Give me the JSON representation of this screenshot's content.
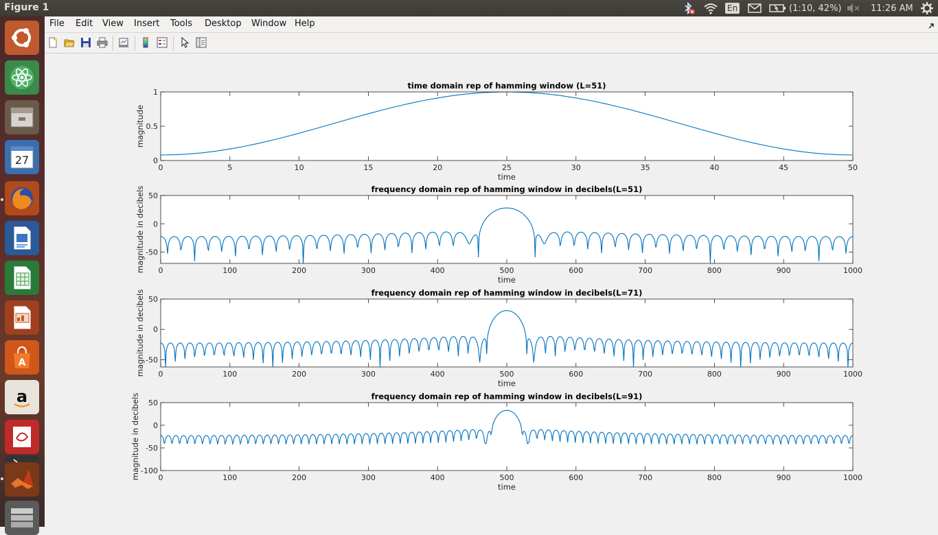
{
  "window": {
    "title": "Figure 1"
  },
  "tray": {
    "keyboard": "En",
    "battery": "(1:10, 42%)",
    "clock": "11:26 AM"
  },
  "launcher": {
    "calendar_day": "27"
  },
  "menu": [
    "File",
    "Edit",
    "View",
    "Insert",
    "Tools",
    "Desktop",
    "Window",
    "Help"
  ],
  "colors": {
    "line": "#0072bd",
    "figure_bg": "#f0f0f0",
    "axes_bg": "#ffffff"
  },
  "chart_data": [
    {
      "type": "line",
      "title": "time domain rep of hamming window (L=51)",
      "xlabel": "time",
      "ylabel": "magnitude",
      "xlim": [
        0,
        50
      ],
      "ylim": [
        0,
        1
      ],
      "xticks": [
        0,
        5,
        10,
        15,
        20,
        25,
        30,
        35,
        40,
        45,
        50
      ],
      "yticks": [
        0,
        0.5,
        1
      ],
      "ytick_labels": [
        "0",
        "0.5",
        "1"
      ],
      "series": [
        {
          "function": "hamming",
          "L": 51,
          "x_start": 0,
          "x_end": 50
        }
      ]
    },
    {
      "type": "line",
      "title": "frequency domain rep of hamming window in decibels(L=51)",
      "xlabel": "time",
      "ylabel": "magnitude in decibels",
      "xlim": [
        0,
        1000
      ],
      "ylim": [
        -70,
        50
      ],
      "xticks": [
        0,
        100,
        200,
        300,
        400,
        500,
        600,
        700,
        800,
        900,
        1000
      ],
      "yticks": [
        -50,
        0,
        50
      ],
      "series": [
        {
          "function": "hamming_spectrum_db",
          "L": 51,
          "N": 1000,
          "center": 500,
          "peak_db": 28
        }
      ]
    },
    {
      "type": "line",
      "title": "frequency domain rep of hamming window in decibels(L=71)",
      "xlabel": "time",
      "ylabel": "magnitude in decibels",
      "xlim": [
        0,
        1000
      ],
      "ylim": [
        -62,
        50
      ],
      "xticks": [
        0,
        100,
        200,
        300,
        400,
        500,
        600,
        700,
        800,
        900,
        1000
      ],
      "yticks": [
        -50,
        0,
        50
      ],
      "series": [
        {
          "function": "hamming_spectrum_db",
          "L": 71,
          "N": 1000,
          "center": 500,
          "peak_db": 31
        }
      ]
    },
    {
      "type": "line",
      "title": "frequency domain rep of hamming window in decibels(L=91)",
      "xlabel": "time",
      "ylabel": "magnitude in decibels",
      "xlim": [
        0,
        1000
      ],
      "ylim": [
        -100,
        50
      ],
      "xticks": [
        0,
        100,
        200,
        300,
        400,
        500,
        600,
        700,
        800,
        900,
        1000
      ],
      "yticks": [
        -100,
        -50,
        0,
        50
      ],
      "series": [
        {
          "function": "hamming_spectrum_db",
          "L": 91,
          "N": 1000,
          "center": 500,
          "peak_db": 33
        }
      ]
    }
  ]
}
